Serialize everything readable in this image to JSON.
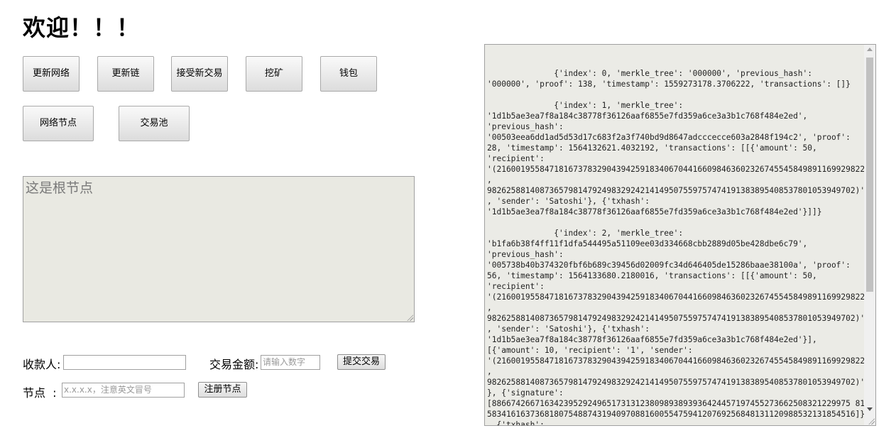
{
  "page": {
    "title": "欢迎！！！"
  },
  "buttons": {
    "update_network": "更新网络",
    "update_chain": "更新链",
    "accept_transaction": "接受新交易",
    "mine": "挖矿",
    "wallet": "钱包",
    "network_nodes": "网络节点",
    "transaction_pool": "交易池"
  },
  "root_node": {
    "placeholder": "这是根节点"
  },
  "transaction_form": {
    "recipient_label": "收款人:",
    "recipient_value": "",
    "amount_label": "交易金额:",
    "amount_placeholder": "请输入数字",
    "submit_label": "提交交易"
  },
  "node_form": {
    "node_label": "节点  :",
    "node_placeholder": "x.x.x.x，注意英文冒号",
    "register_label": "注册节点"
  },
  "chain_output": {
    "text": "              {'index': 0, 'merkle_tree': '000000', 'previous_hash':\n'000000', 'proof': 138, 'timestamp': 1559273178.3706222, 'transactions': []}\n\n              {'index': 1, 'merkle_tree':\n'1d1b5ae3ea7f8a184c38778f36126aaf6855e7fd359a6ce3a3b1c768f484e2ed',\n'previous_hash':\n'00503eea6dd1ad5d53d17c683f2a3f740bd9d8647adcccecce603a2848f194c2', 'proof':\n28, 'timestamp': 1564132621.4032192, 'transactions': [[{'amount': 50,\n'recipient':\n'(21600195584718167378329043942591834067044166098463602326745545849891169929822\n,\n98262588140873657981479249832924214149507559757474191383895408537801053949702)'\n, 'sender': 'Satoshi'}, {'txhash':\n'1d1b5ae3ea7f8a184c38778f36126aaf6855e7fd359a6ce3a3b1c768f484e2ed'}]]}\n\n              {'index': 2, 'merkle_tree':\n'b1fa6b38f4ff11f1dfa544495a51109ee03d334668cbb2889d05be428dbe6c79',\n'previous_hash':\n'005738b40b374320fbf6b689c39456d02009fc34d646405de15286baae38100a', 'proof':\n56, 'timestamp': 1564133680.2180016, 'transactions': [[{'amount': 50,\n'recipient':\n'(21600195584718167378329043942591834067044166098463602326745545849891169929822\n,\n98262588140873657981479249832924214149507559757474191383895408537801053949702)'\n, 'sender': 'Satoshi'}, {'txhash':\n'1d1b5ae3ea7f8a184c38778f36126aaf6855e7fd359a6ce3a3b1c768f484e2ed'}],\n[{'amount': 10, 'recipient': '1', 'sender':\n'(21600195584718167378329043942591834067044166098463602326745545849891169929822\n,\n98262588140873657981479249832924214149507559757474191383895408537801053949702)'\n}, {'signature':\n[886674266716342395292496517313123809893893936424457197455273662508321229975 81,\n58341616373681807548874319409708816005547594120769256848131120988532131854516]}\n, {'txhash':"
  },
  "icons": {
    "scroll_up": "scroll-up-arrow-icon",
    "scroll_down": "scroll-down-arrow-icon",
    "resize": "resize-grip-icon"
  }
}
